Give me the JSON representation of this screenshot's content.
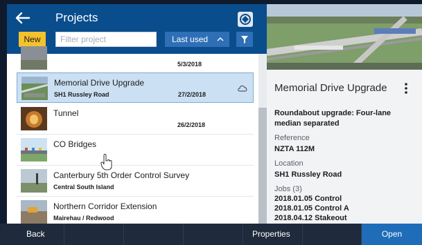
{
  "header": {
    "title": "Projects",
    "new_label": "New",
    "filter_placeholder": "Filter project",
    "sort_label": "Last used",
    "sort_chevron": "^"
  },
  "projects": [
    {
      "title": "",
      "sub": "",
      "date": "5/3/2018"
    },
    {
      "title": "Memorial Drive Upgrade",
      "sub": "SH1 Russley Road",
      "date": "27/2/2018"
    },
    {
      "title": "Tunnel",
      "sub": "",
      "date": "26/2/2018"
    },
    {
      "title": "CO Bridges",
      "sub": "",
      "date": ""
    },
    {
      "title": "Canterbury 5th Order Control Survey",
      "sub": "Central South Island",
      "date": ""
    },
    {
      "title": "Northern Corridor Extension",
      "sub": "Mairehau / Redwood",
      "date": ""
    }
  ],
  "detail": {
    "title": "Memorial Drive Upgrade",
    "description": "Roundabout upgrade:  Four-lane median separated",
    "reference_label": "Reference",
    "reference_value": "NZTA 112M",
    "location_label": "Location",
    "location_value": "SH1 Russley Road",
    "jobs_label": "Jobs (3)",
    "jobs": [
      "2018.01.05 Control",
      "2018.01.05 Control A",
      "2018.04.12 Stakeout"
    ]
  },
  "bottom": {
    "back_label": "Back",
    "properties_label": "Properties",
    "open_label": "Open"
  },
  "colors": {
    "header_blue": "#0a4d8c",
    "accent_blue": "#2e6fb6",
    "new_yellow": "#f4c22d",
    "selection": "#cbe0f3",
    "open_blue": "#1f6db8"
  }
}
